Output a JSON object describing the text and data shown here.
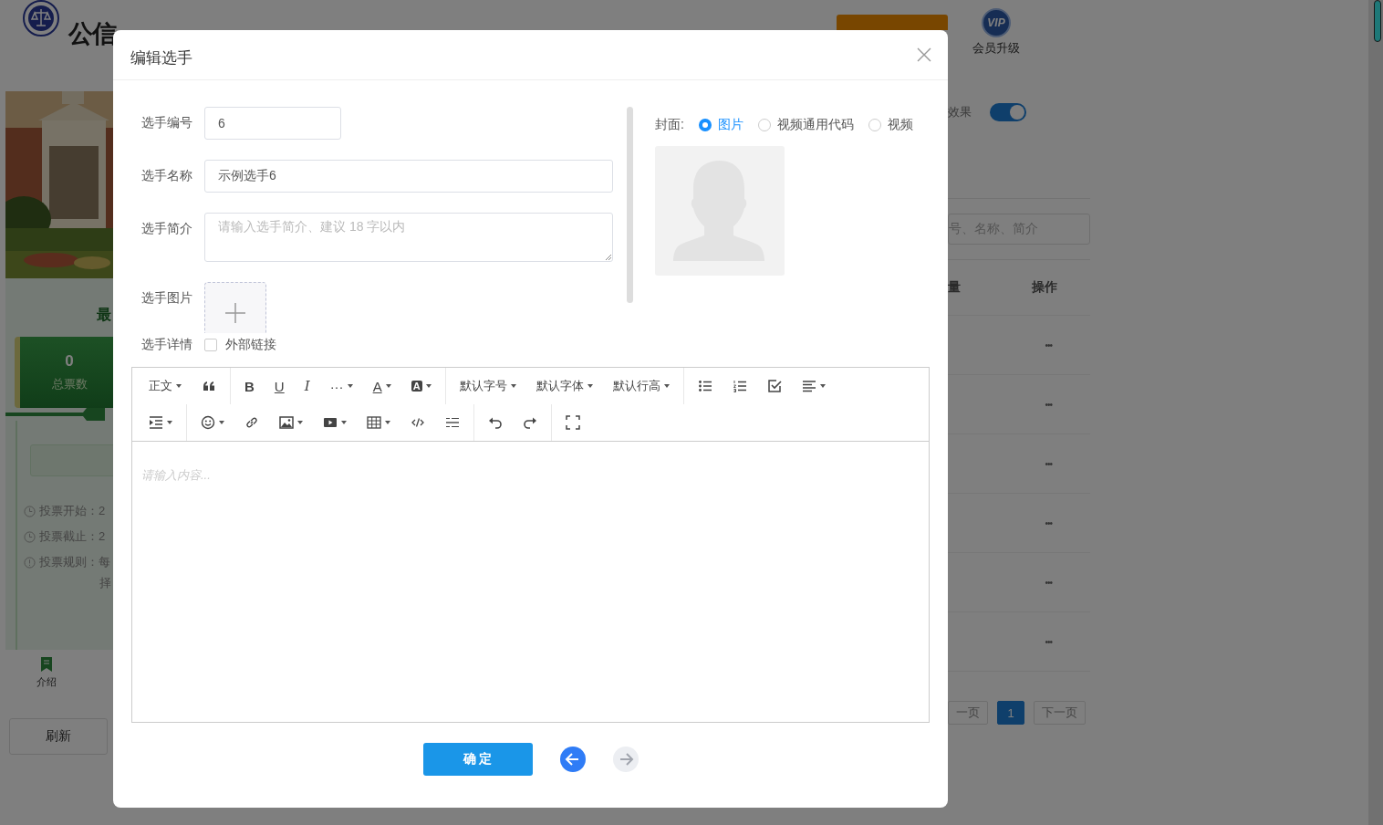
{
  "header": {
    "brand": "公信",
    "vip_badge": "VIP",
    "vip_label": "会员升级"
  },
  "left_panel": {
    "title": "最",
    "stat_value": "0",
    "stat_label": "总票数",
    "info": [
      {
        "kind": "time",
        "label": "投票开始：",
        "value": "2"
      },
      {
        "kind": "time",
        "label": "投票截止：",
        "value": "2"
      },
      {
        "kind": "rule",
        "label": "投票规则：",
        "value": "每"
      }
    ],
    "info_wrap": "择",
    "tab": "介绍",
    "refresh": "刷新"
  },
  "right_panel": {
    "toggle_label": "效果",
    "toggle_on": true,
    "search_placeholder": "号、名称、简介",
    "columns": [
      "量",
      "操作"
    ],
    "rows": [
      {
        "action": "•••"
      },
      {
        "action": "•••"
      },
      {
        "action": "•••"
      },
      {
        "action": "•••"
      },
      {
        "action": "•••"
      },
      {
        "action": "•••"
      }
    ],
    "pagination": {
      "prev": "一页",
      "pages": [
        {
          "label": "1",
          "selected": true
        }
      ],
      "next": "下一页"
    }
  },
  "dialog": {
    "title": "编辑选手",
    "fields": [
      {
        "kind": "short-input",
        "label": "选手编号",
        "value": "6"
      },
      {
        "kind": "input",
        "label": "选手名称",
        "value": "示例选手6"
      },
      {
        "kind": "textarea",
        "label": "选手简介",
        "placeholder": "请输入选手简介、建议 18 字以内"
      },
      {
        "kind": "upload",
        "label": "选手图片"
      }
    ],
    "detail": {
      "label": "选手详情",
      "checkbox_label": "外部链接",
      "checked": false
    },
    "cover": {
      "label": "封面:",
      "options": [
        {
          "label": "图片",
          "selected": true
        },
        {
          "label": "视频通用代码",
          "selected": false
        },
        {
          "label": "视频",
          "selected": false
        }
      ]
    },
    "editor": {
      "toolbar": [
        [
          [
            {
              "kind": "menu",
              "label": "正文"
            },
            {
              "kind": "icon"
            }
          ],
          [
            {
              "kind": "glyph",
              "label": "B"
            },
            {
              "kind": "glyph",
              "label": "U"
            },
            {
              "kind": "glyph",
              "label": "I"
            },
            {
              "kind": "glyph-menu",
              "label": "···"
            },
            {
              "kind": "glyph-menu",
              "label": "A"
            },
            {
              "kind": "glyph-menu",
              "label": "A"
            }
          ],
          [
            {
              "kind": "menu",
              "label": "默认字号"
            },
            {
              "kind": "menu",
              "label": "默认字体"
            },
            {
              "kind": "menu",
              "label": "默认行高"
            }
          ],
          [
            {
              "kind": "icon"
            },
            {
              "kind": "icon"
            },
            {
              "kind": "icon"
            },
            {
              "kind": "icon-menu"
            }
          ]
        ],
        [
          [
            {
              "kind": "icon-menu"
            }
          ],
          [
            {
              "kind": "icon-menu"
            },
            {
              "kind": "icon"
            },
            {
              "kind": "icon-menu"
            },
            {
              "kind": "icon-menu"
            },
            {
              "kind": "icon-menu"
            },
            {
              "kind": "icon"
            },
            {
              "kind": "icon"
            }
          ],
          [
            {
              "kind": "icon"
            },
            {
              "kind": "icon"
            }
          ],
          [
            {
              "kind": "icon"
            }
          ]
        ]
      ],
      "placeholder": "请输入内容..."
    },
    "confirm": "确 定",
    "nav": [
      {
        "kind": "prev",
        "disabled": false
      },
      {
        "kind": "next",
        "disabled": true
      }
    ]
  }
}
